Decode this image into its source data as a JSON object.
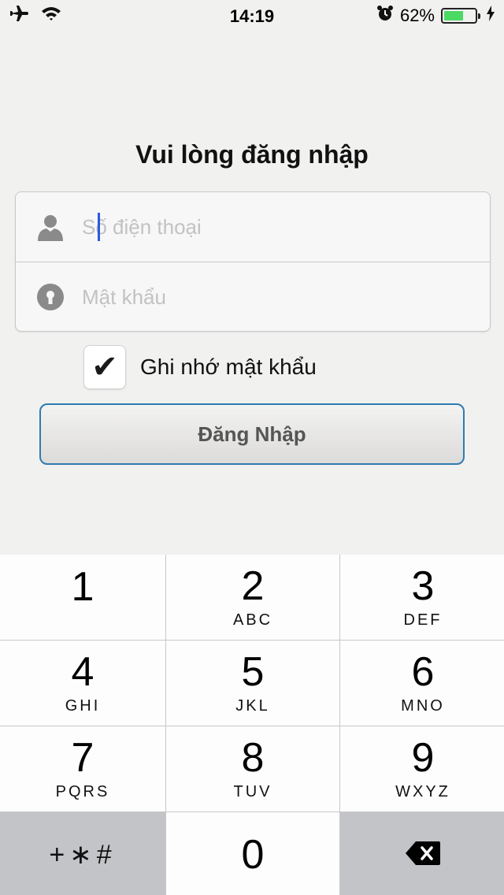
{
  "status_bar": {
    "time": "14:19",
    "battery_percent": "62%",
    "battery_level": 0.62,
    "battery_color": "#4cd964",
    "icons": [
      "airplane-icon",
      "wifi-icon",
      "alarm-icon",
      "battery-icon",
      "charging-icon"
    ]
  },
  "title": "Vui lòng đăng nhập",
  "form": {
    "phone_placeholder": "Số điện thoại",
    "password_placeholder": "Mật khẩu"
  },
  "remember": {
    "checked": true,
    "mark": "✔",
    "label": "Ghi nhớ mật khẩu"
  },
  "login_button": "Đăng Nhập",
  "accent_color": "#2f7bb0",
  "keypad": {
    "keys": [
      {
        "digit": "1",
        "letters": ""
      },
      {
        "digit": "2",
        "letters": "ABC"
      },
      {
        "digit": "3",
        "letters": "DEF"
      },
      {
        "digit": "4",
        "letters": "GHI"
      },
      {
        "digit": "5",
        "letters": "JKL"
      },
      {
        "digit": "6",
        "letters": "MNO"
      },
      {
        "digit": "7",
        "letters": "PQRS"
      },
      {
        "digit": "8",
        "letters": "TUV"
      },
      {
        "digit": "9",
        "letters": "WXYZ"
      }
    ],
    "symbols": "+∗#",
    "zero": "0"
  }
}
